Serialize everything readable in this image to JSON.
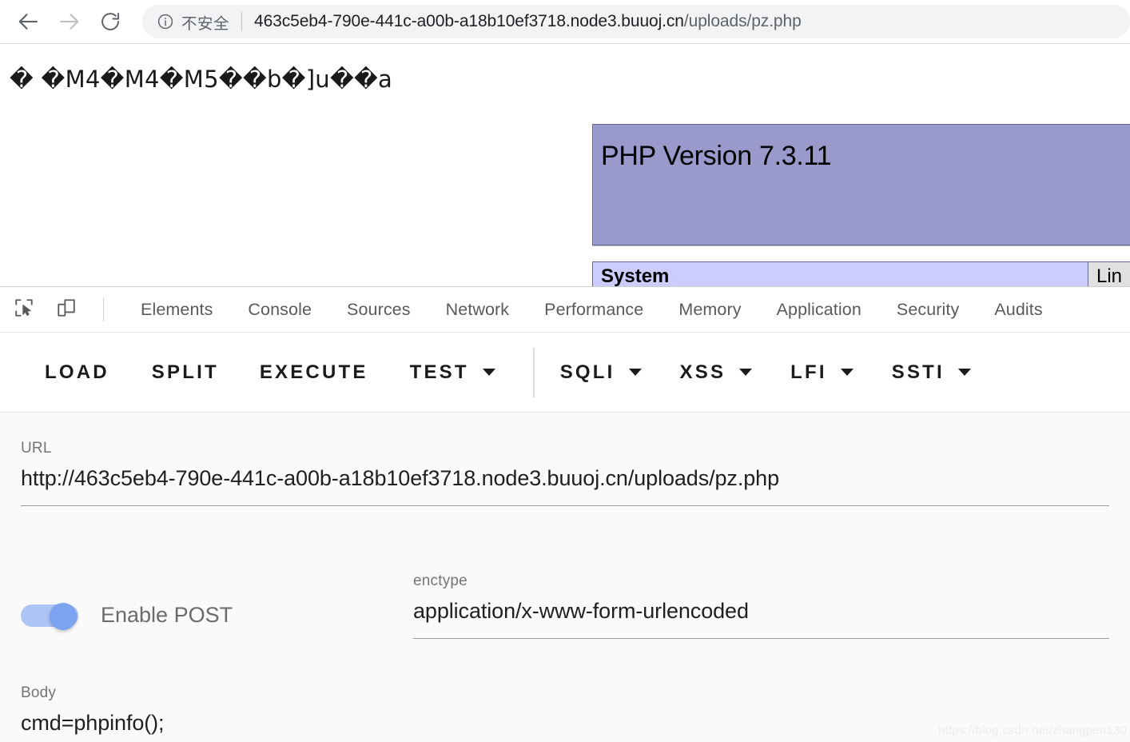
{
  "browser": {
    "back_icon": "arrow-left-icon",
    "forward_icon": "arrow-right-icon",
    "reload_icon": "reload-icon",
    "info_icon": "info-circle-icon",
    "security_text": "不安全",
    "url_host": "463c5eb4-790e-441c-a00b-a18b10ef3718.node3.buuoj.cn",
    "url_path": "/uploads/pz.php"
  },
  "page": {
    "garbled_text": "� �M4�M4�M5��b�]u��a",
    "phpinfo": {
      "version_title": "PHP Version 7.3.11",
      "rows": [
        {
          "key": "System",
          "value": "Lin"
        }
      ]
    }
  },
  "devtools": {
    "inspect_icon": "inspect-element-icon",
    "device_icon": "device-toolbar-icon",
    "tabs": [
      {
        "label": "Elements"
      },
      {
        "label": "Console"
      },
      {
        "label": "Sources"
      },
      {
        "label": "Network"
      },
      {
        "label": "Performance"
      },
      {
        "label": "Memory"
      },
      {
        "label": "Application"
      },
      {
        "label": "Security"
      },
      {
        "label": "Audits"
      }
    ]
  },
  "hackbar": {
    "actions": [
      {
        "label": "LOAD",
        "caret": false
      },
      {
        "label": "SPLIT",
        "caret": false
      },
      {
        "label": "EXECUTE",
        "caret": false
      },
      {
        "label": "TEST",
        "caret": true
      }
    ],
    "payloads": [
      {
        "label": "SQLI",
        "caret": true
      },
      {
        "label": "XSS",
        "caret": true
      },
      {
        "label": "LFI",
        "caret": true
      },
      {
        "label": "SSTI",
        "caret": true
      }
    ],
    "url_label": "URL",
    "url_value": "http://463c5eb4-790e-441c-a00b-a18b10ef3718.node3.buuoj.cn/uploads/pz.php",
    "post_toggle_label": "Enable POST",
    "post_toggle_state": "on",
    "enctype_label": "enctype",
    "enctype_value": "application/x-www-form-urlencoded",
    "body_label": "Body",
    "body_value": "cmd=phpinfo();"
  },
  "watermark": "https://blog.csdn.net/zhangpen130",
  "colors": {
    "php_version_bg": "#9999cc",
    "php_row_key_bg": "#ccccff",
    "php_row_value_bg": "#e0e0e0",
    "toggle_on": "#7ba3f0",
    "omnibox_bg": "#f1f3f4"
  }
}
